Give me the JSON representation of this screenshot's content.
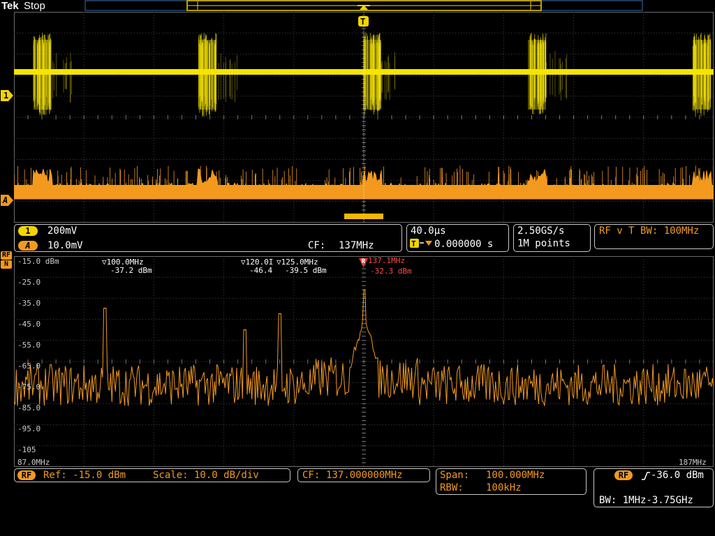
{
  "header": {
    "brand": "Tek",
    "acq_state": "Stop"
  },
  "time_domain": {
    "ch1_marker": "1",
    "math_marker": "A",
    "trigger_marker": "T",
    "colors": {
      "ch1": "#f5e400",
      "math": "#f39a1e",
      "grid": "#444444"
    }
  },
  "status_bar": {
    "ch1": {
      "badge": "1",
      "scale": "200mV"
    },
    "math": {
      "badge": "A",
      "scale": "10.0mV",
      "cf_label": "CF:",
      "cf_value": "137MHz"
    },
    "timebase": {
      "scale": "40.0µs",
      "trig_pos": "0.000000 s"
    },
    "acq": {
      "rate": "2.50GS/s",
      "record": "1M points"
    },
    "rfvt": {
      "text": "RF v T BW: 100MHz"
    }
  },
  "spectrum": {
    "badge_top": "RF",
    "badge_bottom": "N",
    "x_start": "87.0MHz",
    "x_end": "187MHz",
    "y_ticks": [
      "-15.0 dBm",
      "-25.0",
      "-35.0",
      "-45.0",
      "-55.0",
      "-65.0",
      "-75.0",
      "-85.0",
      "-95.0",
      "-105"
    ],
    "markers": [
      {
        "freq": "100.0MHz",
        "level": "-37.2 dBm",
        "type": "normal"
      },
      {
        "freq": "120.0I",
        "level": "-46.4",
        "type": "normal"
      },
      {
        "freq": "125.0MHz",
        "level": "-39.5 dBm",
        "type": "normal"
      },
      {
        "freq": "137.1MHz",
        "level": "-32.3 dBm",
        "type": "reference",
        "glyph": "R"
      }
    ],
    "color": "#f39a1e"
  },
  "bottom_bar": {
    "rf_badge": "RF",
    "ref": "Ref: -15.0 dBm",
    "scale": "Scale: 10.0 dB/div",
    "cf_label": "CF:",
    "cf_value": "137.000000MHz",
    "span_label": "Span:",
    "span_value": "100.000MHz",
    "rbw_label": "RBW:",
    "rbw_value": "100kHz",
    "trig_badge": "RF",
    "trig_level": "-36.0 dBm",
    "bw": "BW: 1MHz-3.75GHz"
  },
  "chart_data": {
    "type": "line",
    "title": "",
    "xlabel": "",
    "ylabel": "",
    "xlim": [
      87.0,
      187.0
    ],
    "ylim": [
      -105,
      -15
    ],
    "noise_floor_dbm": -70,
    "peaks": [
      {
        "freq_mhz": 100.0,
        "level_dbm": -37.2
      },
      {
        "freq_mhz": 120.0,
        "level_dbm": -46.4
      },
      {
        "freq_mhz": 125.0,
        "level_dbm": -39.5
      },
      {
        "freq_mhz": 137.1,
        "level_dbm": -32.3
      }
    ]
  }
}
